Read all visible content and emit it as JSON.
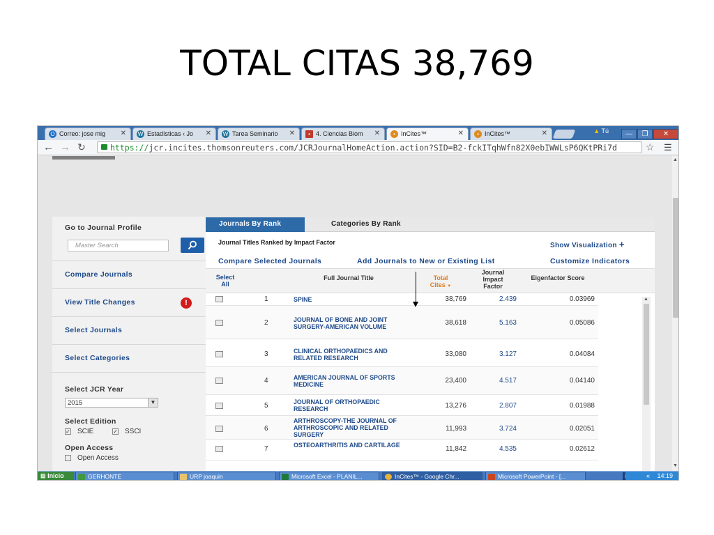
{
  "slide": {
    "title": "TOTAL CITAS 38,769"
  },
  "browser": {
    "tabs": [
      {
        "label": "Correo: jose mig",
        "icon": "outlook-icon",
        "color": "#1f6fc5"
      },
      {
        "label": "Estadísticas ‹ Jo",
        "icon": "wordpress-icon",
        "color": "#21759b"
      },
      {
        "label": "Tarea Seminario",
        "icon": "wordpress-icon",
        "color": "#21759b"
      },
      {
        "label": "4. Ciencias Biom",
        "icon": "document-icon",
        "color": "#c0392b"
      },
      {
        "label": "InCites™",
        "icon": "incites-icon",
        "color": "#e08a1e"
      },
      {
        "label": "InCites™",
        "icon": "incites-icon",
        "color": "#e08a1e"
      }
    ],
    "user_label": "Tú",
    "url_scheme": "https://",
    "url_rest": "jcr.incites.thomsonreuters.com/JCRJournalHomeAction.action?SID=B2-fckITqhWfn82X0ebIWWLsP6QKtPRi7d"
  },
  "sidebar": {
    "go_to_profile": "Go to Journal Profile",
    "master_search_placeholder": "Master Search",
    "compare_journals": "Compare Journals",
    "view_title_changes": "View Title Changes",
    "alert_glyph": "!",
    "select_journals": "Select Journals",
    "select_categories": "Select Categories",
    "select_year_label": "Select JCR Year",
    "year_value": "2015",
    "select_edition_label": "Select Edition",
    "edition_scie": "SCIE",
    "edition_ssci": "SSCI",
    "open_access_label": "Open Access",
    "open_access_option": "Open Access"
  },
  "main": {
    "tab_rank": "Journals By Rank",
    "tab_categories": "Categories By Rank",
    "subheading": "Journal Titles Ranked by Impact Factor",
    "show_visualization": "Show Visualization",
    "plus_glyph": "+",
    "compare_selected": "Compare Selected Journals",
    "add_journals": "Add Journals to New or Existing List",
    "customize": "Customize Indicators",
    "columns": {
      "select_all_1": "Select",
      "select_all_2": "All",
      "full_title": "Full Journal Title",
      "total_cites_1": "Total",
      "total_cites_2": "Cites",
      "sort_glyph": "▼",
      "jif_1": "Journal",
      "jif_2": "Impact",
      "jif_3": "Factor",
      "eigen": "Eigenfactor Score"
    },
    "rows": [
      {
        "rank": "1",
        "title": "SPINE",
        "cites": "38,769",
        "jif": "2.439",
        "eigen": "0.03969"
      },
      {
        "rank": "2",
        "title": "JOURNAL OF BONE AND JOINT SURGERY-AMERICAN VOLUME",
        "cites": "38,618",
        "jif": "5.163",
        "eigen": "0.05086"
      },
      {
        "rank": "3",
        "title": "CLINICAL ORTHOPAEDICS AND RELATED RESEARCH",
        "cites": "33,080",
        "jif": "3.127",
        "eigen": "0.04084"
      },
      {
        "rank": "4",
        "title": "AMERICAN JOURNAL OF SPORTS MEDICINE",
        "cites": "23,400",
        "jif": "4.517",
        "eigen": "0.04140"
      },
      {
        "rank": "5",
        "title": "JOURNAL OF ORTHOPAEDIC RESEARCH",
        "cites": "13,276",
        "jif": "2.807",
        "eigen": "0.01988"
      },
      {
        "rank": "6",
        "title": "ARTHROSCOPY-THE JOURNAL OF ARTHROSCOPIC AND RELATED SURGERY",
        "cites": "11,993",
        "jif": "3.724",
        "eigen": "0.02051"
      },
      {
        "rank": "7",
        "title": "OSTEOARTHRITIS AND CARTILAGE",
        "cites": "11,842",
        "jif": "4.535",
        "eigen": "0.02612"
      }
    ]
  },
  "taskbar": {
    "start": "Inicio",
    "items": [
      {
        "label": "GERHONTE",
        "icon": "network-icon"
      },
      {
        "label": "URP joaquin",
        "icon": "folder-icon"
      },
      {
        "label": "Microsoft Excel - PLANIL...",
        "icon": "excel-icon"
      },
      {
        "label": "InCites™ - Google Chr...",
        "icon": "chrome-icon"
      },
      {
        "label": "Microsoft PowerPoint - [...",
        "icon": "powerpoint-icon"
      }
    ],
    "lang": "ES",
    "clock": "14:19",
    "tray_arrows": "«"
  }
}
